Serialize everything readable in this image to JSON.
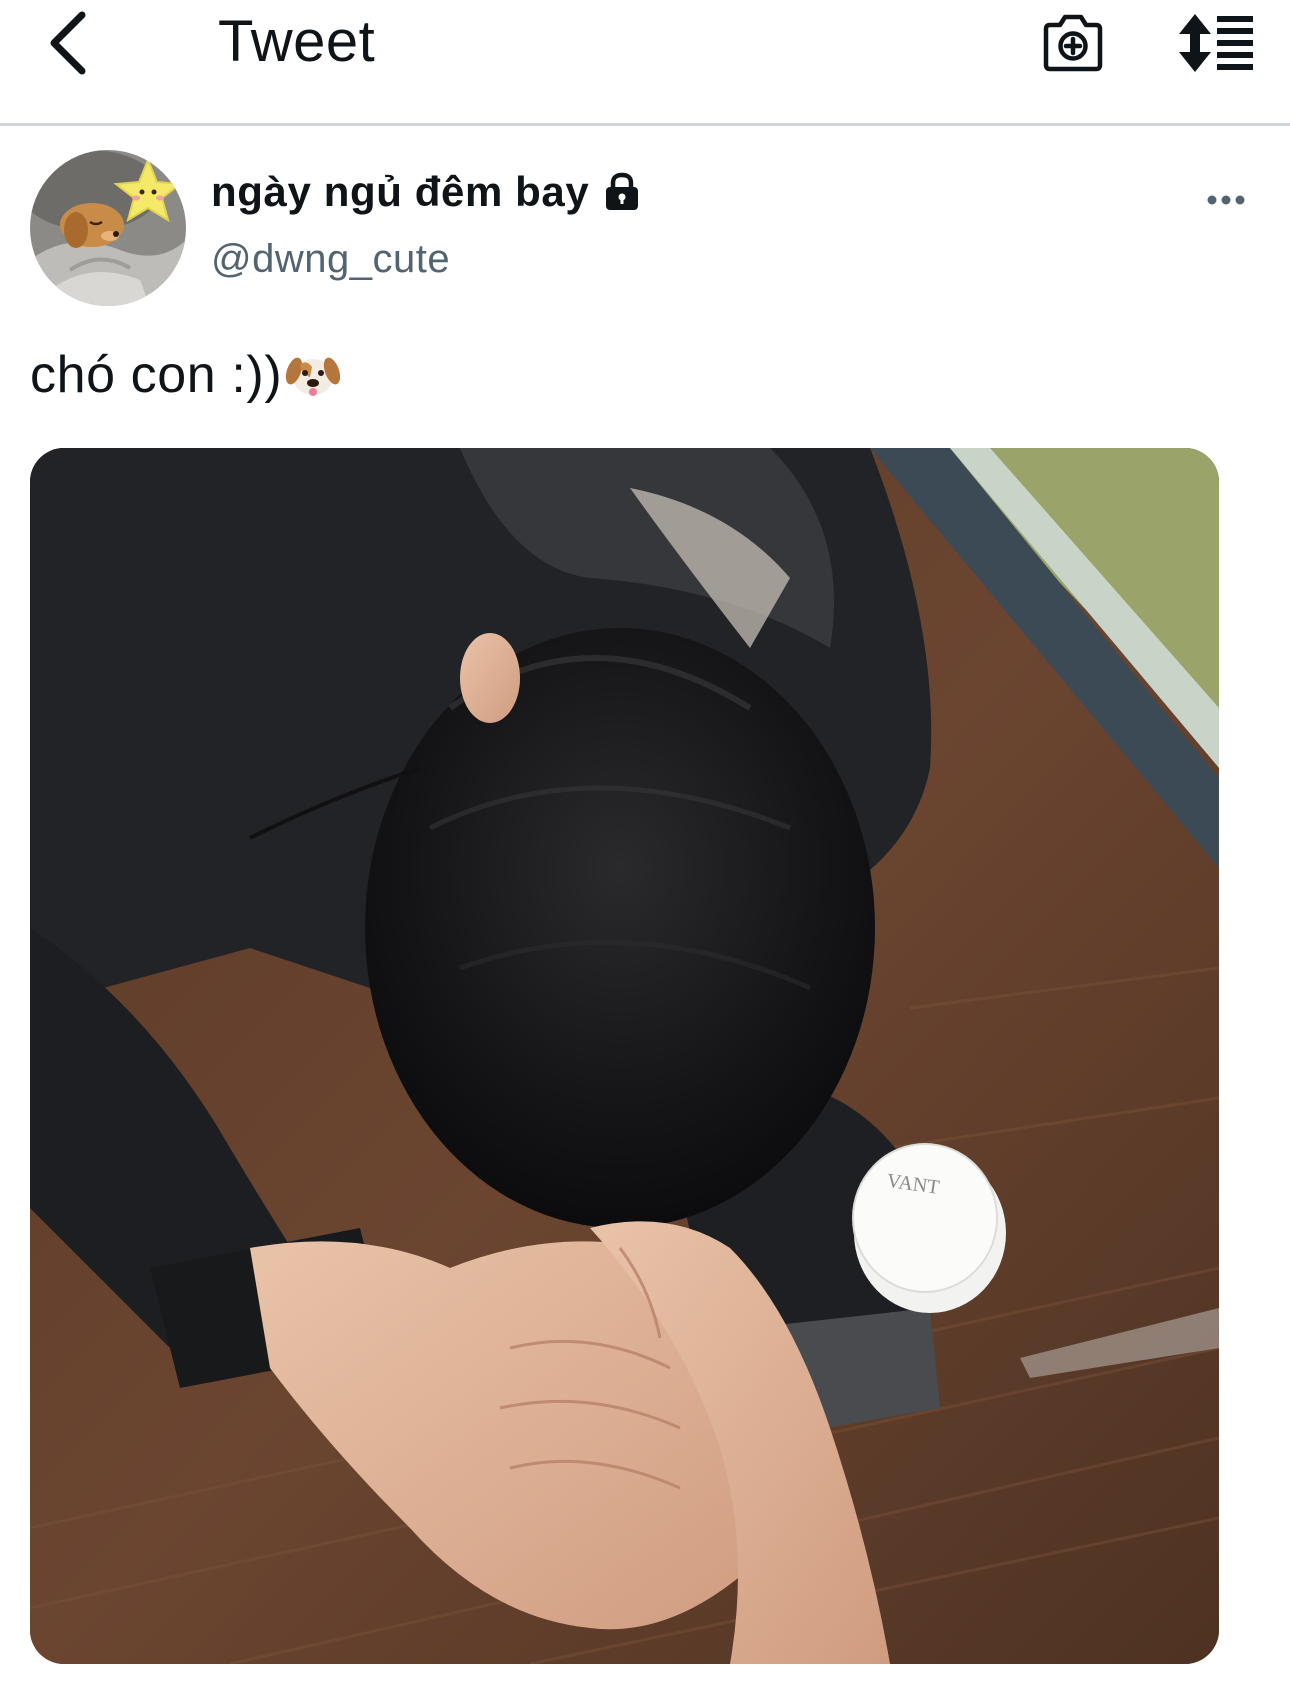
{
  "header": {
    "title": "Tweet",
    "back_icon": "chevron-left-icon",
    "camera_icon": "camera-plus-icon",
    "sort_icon": "sort-list-icon"
  },
  "tweet": {
    "author": {
      "display_name": "ngày ngủ đêm bay",
      "handle": "@dwng_cute",
      "protected_icon": "lock-icon",
      "avatar": "avatar-puppy-star"
    },
    "more_icon": "more-dots-icon",
    "text": "chó con :))",
    "text_emoji": "dog-face-emoji",
    "media": {
      "type": "photo",
      "product_label": "VANT"
    }
  },
  "colors": {
    "text_primary": "#0f1419",
    "text_secondary": "#536471",
    "divider": "#cfd5da",
    "background": "#ffffff"
  }
}
